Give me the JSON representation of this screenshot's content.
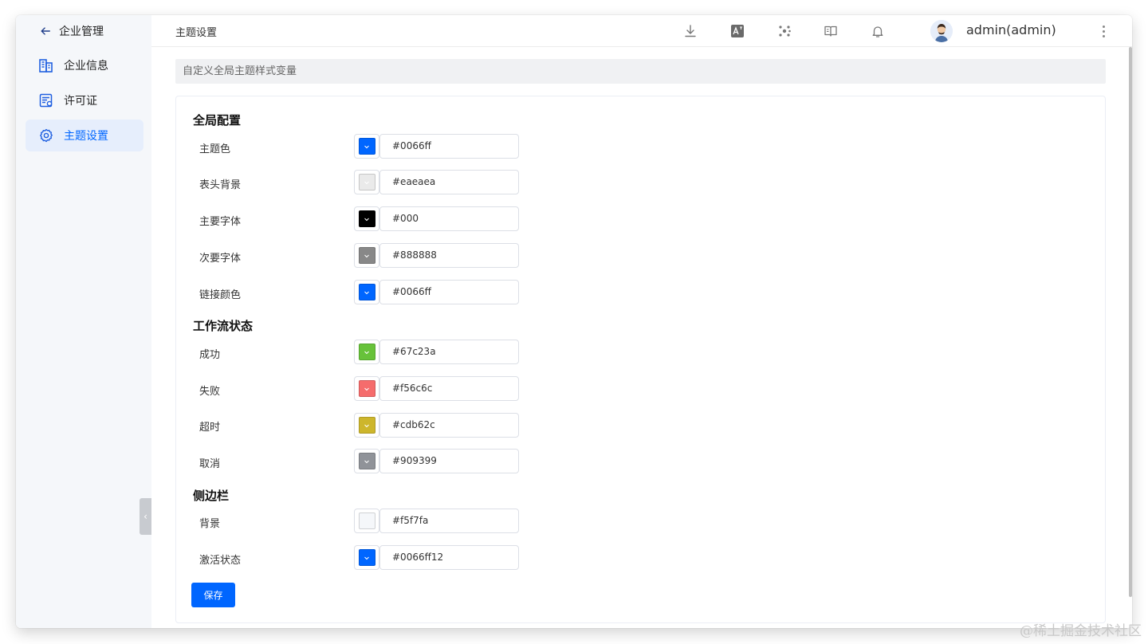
{
  "sidebar": {
    "back_label": "企业管理",
    "items": [
      {
        "label": "企业信息",
        "icon": "building-icon"
      },
      {
        "label": "许可证",
        "icon": "license-icon"
      },
      {
        "label": "主题设置",
        "icon": "gear-icon"
      }
    ],
    "active_color": "#0066ff"
  },
  "header": {
    "title": "主题设置",
    "icons": [
      "download-icon",
      "translate-icon",
      "cluster-icon",
      "book-icon",
      "bell-icon"
    ],
    "username": "admin(admin)"
  },
  "banner": {
    "text": "自定义全局主题样式变量"
  },
  "sections": [
    {
      "title": "全局配置",
      "rows": [
        {
          "label": "主题色",
          "value": "#0066ff",
          "color": "#0066ff"
        },
        {
          "label": "表头背景",
          "value": "#eaeaea",
          "color": "#eaeaea"
        },
        {
          "label": "主要字体",
          "value": "#000",
          "color": "#000000"
        },
        {
          "label": "次要字体",
          "value": "#888888",
          "color": "#888888"
        },
        {
          "label": "链接颜色",
          "value": "#0066ff",
          "color": "#0066ff"
        }
      ]
    },
    {
      "title": "工作流状态",
      "rows": [
        {
          "label": "成功",
          "value": "#67c23a",
          "color": "#67c23a"
        },
        {
          "label": "失败",
          "value": "#f56c6c",
          "color": "#f56c6c"
        },
        {
          "label": "超时",
          "value": "#cdb62c",
          "color": "#cdb62c"
        },
        {
          "label": "取消",
          "value": "#909399",
          "color": "#909399"
        }
      ]
    },
    {
      "title": "侧边栏",
      "rows": [
        {
          "label": "背景",
          "value": "#f5f7fa",
          "color": "#f5f7fa"
        },
        {
          "label": "激活状态",
          "value": "#0066ff12",
          "color": "#0066ff"
        }
      ]
    }
  ],
  "save_label": "保存",
  "watermark": "@稀土掘金技术社区"
}
